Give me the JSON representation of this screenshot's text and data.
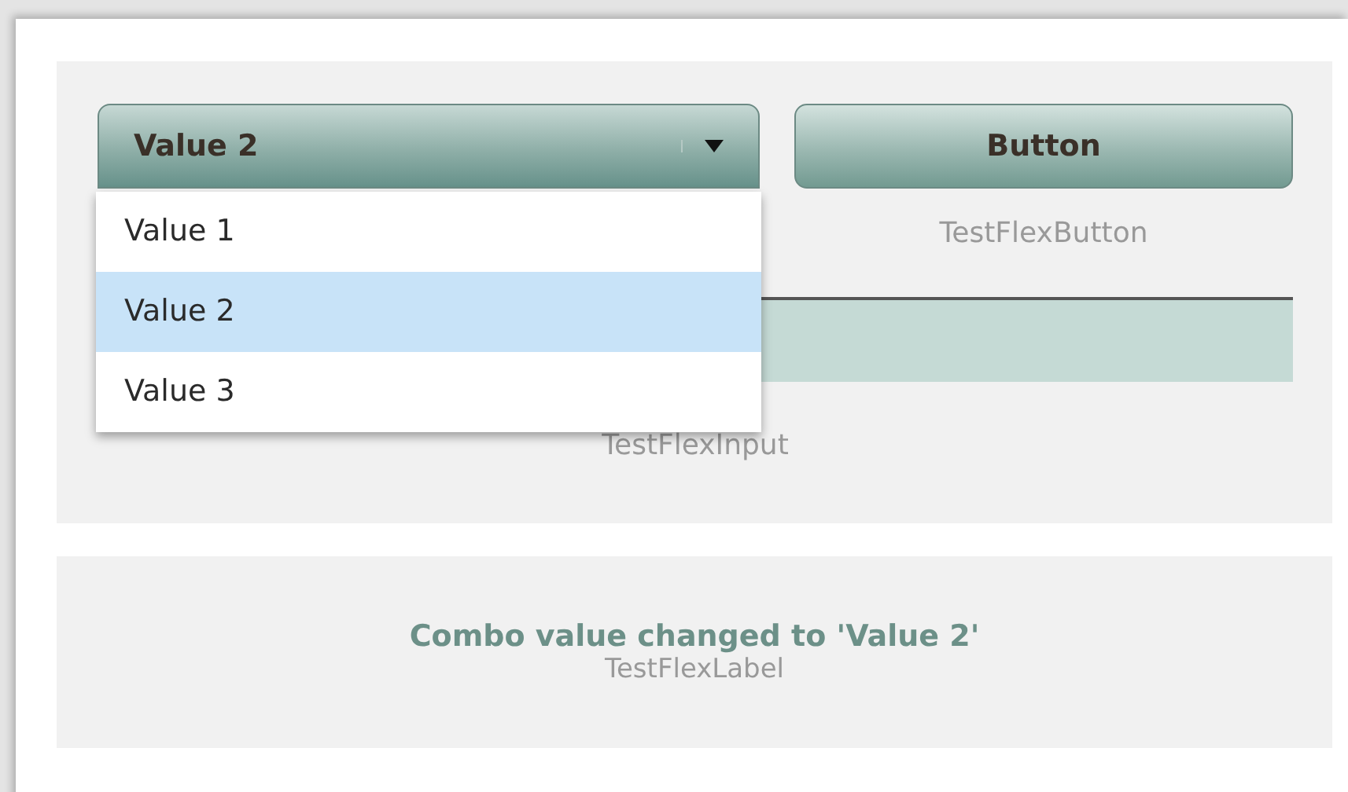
{
  "combo": {
    "value": "Value 2",
    "expanded": true,
    "options": [
      {
        "label": "Value 1",
        "selected": false
      },
      {
        "label": "Value 2",
        "selected": true
      },
      {
        "label": "Value 3",
        "selected": false
      }
    ]
  },
  "button": {
    "label": "Button",
    "caption": "TestFlexButton"
  },
  "input": {
    "caption": "TestFlexInput"
  },
  "status": {
    "message": "Combo value changed to 'Value 2'",
    "caption": "TestFlexLabel"
  }
}
